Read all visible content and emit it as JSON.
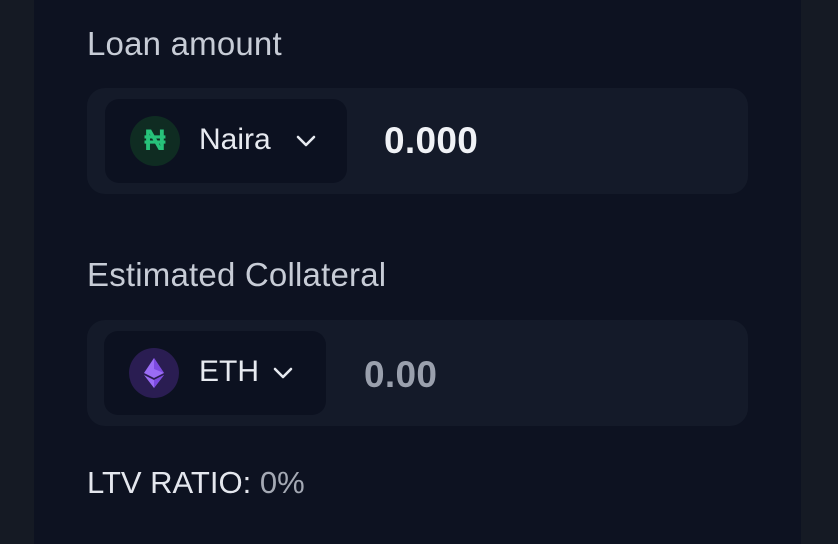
{
  "loan": {
    "label": "Loan amount",
    "currency": {
      "symbol": "₦",
      "name": "Naira",
      "icon": "naira-coin-icon"
    },
    "amount": "0.000"
  },
  "collateral": {
    "label": "Estimated Collateral",
    "currency": {
      "name": "ETH",
      "icon": "ethereum-icon"
    },
    "amount": "0.00"
  },
  "ltv": {
    "label": "LTV RATIO:",
    "value": "0%"
  },
  "colors": {
    "background": "#0d1221",
    "field": "#141a29",
    "naira_accent": "#27c17a",
    "eth_accent": "#8b5cf6"
  }
}
